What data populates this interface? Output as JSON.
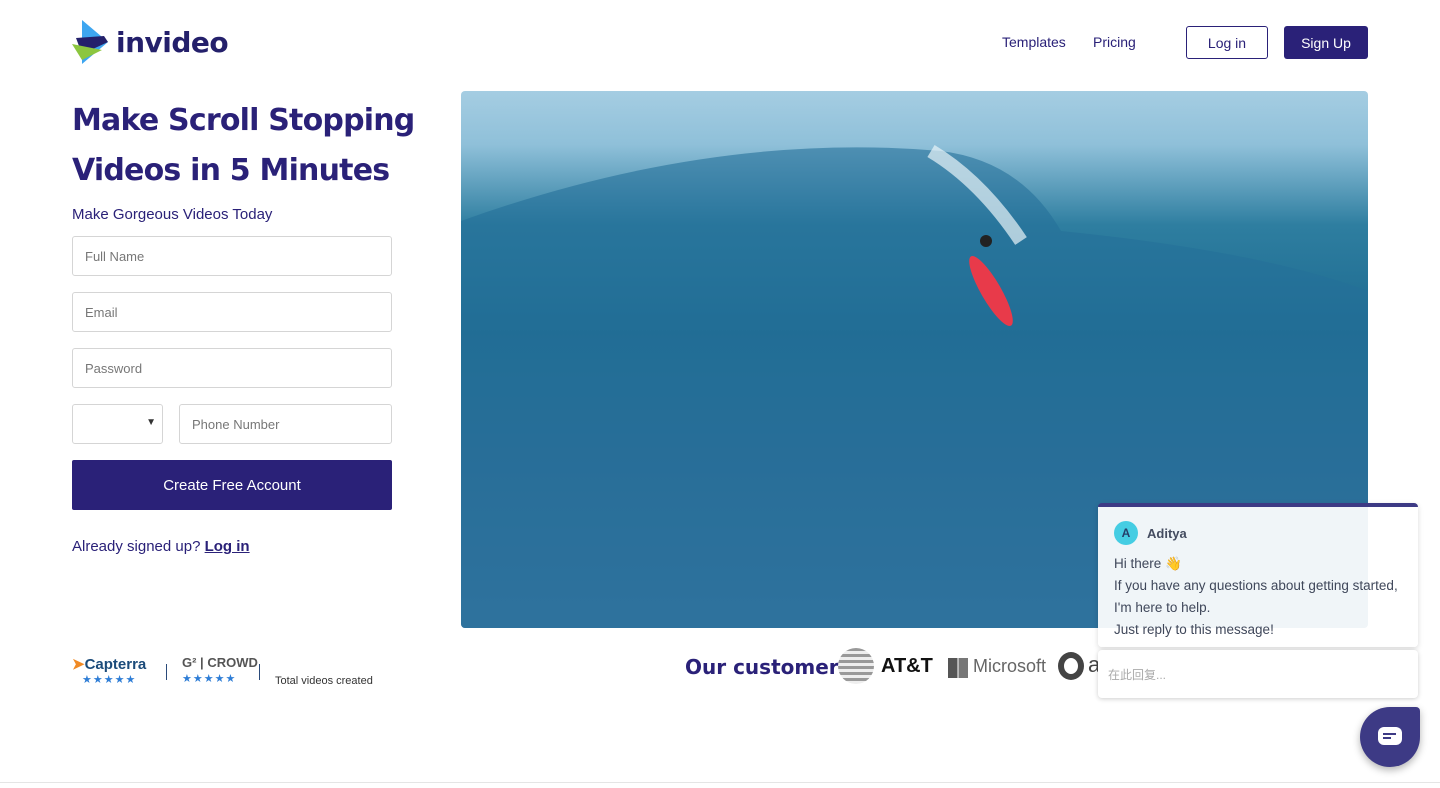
{
  "header": {
    "brand": "invideo",
    "nav": [
      "Templates",
      "Pricing"
    ],
    "login": "Log in",
    "signup": "Sign Up"
  },
  "hero": {
    "title": "Make Scroll Stopping Videos in 5 Minutes",
    "subtitle": "Make Gorgeous Videos Today"
  },
  "form": {
    "full_name": "Full Name",
    "email": "Email",
    "password": "Password",
    "phone": "Phone Number",
    "country_code": "",
    "submit": "Create Free Account",
    "already": "Already signed up?",
    "login_link": "Log in"
  },
  "ratings": {
    "capterra": "Capterra",
    "g2": "CROWD",
    "stars": "★★★★★",
    "total_label": "Total videos created"
  },
  "customers": {
    "label": "Our customers:",
    "logos": [
      "AT&T",
      "Microsoft",
      "a"
    ]
  },
  "chat": {
    "agent_initial": "A",
    "agent": "Aditya",
    "lines": [
      "Hi there 👋",
      "If you have any questions about getting started, I'm here to help.",
      "Just reply to this message!"
    ],
    "reply_placeholder": "在此回复..."
  },
  "colors": {
    "primary": "#2a2178",
    "chat": "#3d3a85",
    "avatar": "#45cde3"
  }
}
